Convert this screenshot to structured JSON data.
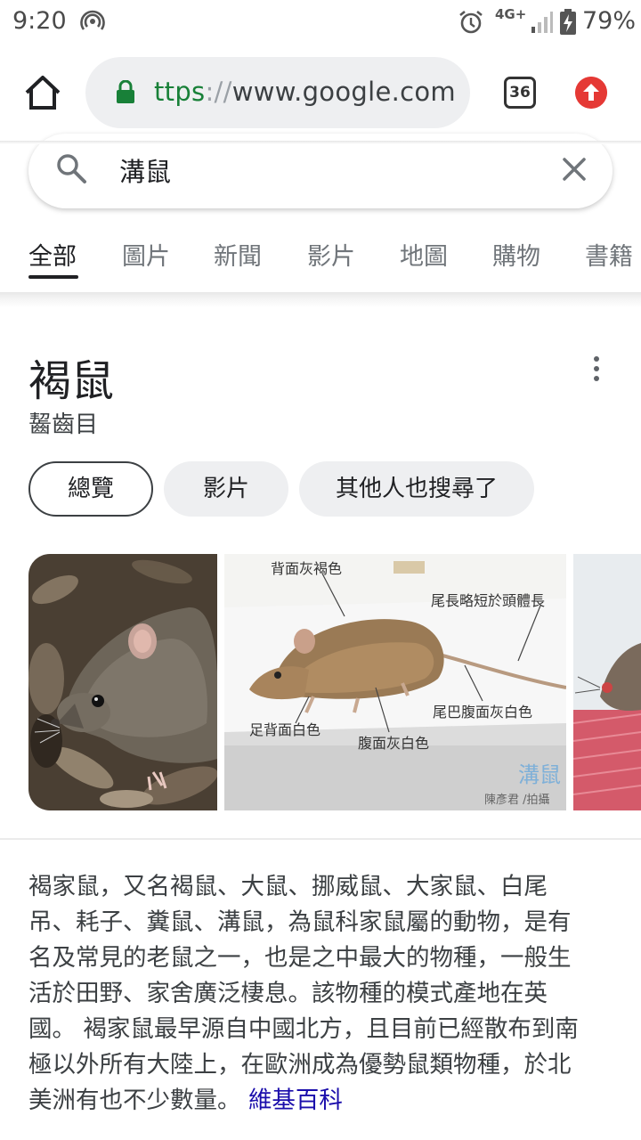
{
  "status_bar": {
    "time": "9:20",
    "network": "4G+",
    "battery": "79%"
  },
  "browser": {
    "url_scheme": "ttps",
    "url_sep": "://",
    "url_host": "www.google.com",
    "tab_count": "36",
    "icons": {
      "home": "home-icon",
      "lock": "lock-icon",
      "update": "update-arrow-icon"
    }
  },
  "search": {
    "query": "溝鼠",
    "icons": {
      "search": "search-icon",
      "clear": "close-icon"
    }
  },
  "tabs": [
    {
      "label": "全部",
      "selected": true
    },
    {
      "label": "圖片",
      "selected": false
    },
    {
      "label": "新聞",
      "selected": false
    },
    {
      "label": "影片",
      "selected": false
    },
    {
      "label": "地圖",
      "selected": false
    },
    {
      "label": "購物",
      "selected": false
    },
    {
      "label": "書籍",
      "selected": false
    }
  ],
  "knowledge_panel": {
    "title": "褐鼠",
    "subtitle": "齧齒目",
    "chips": [
      "總覽",
      "影片",
      "其他人也搜尋了"
    ],
    "image_labels": {
      "back": "背面灰褐色",
      "tail_length": "尾長略短於頭體長",
      "tail_belly": "尾巴腹面灰白色",
      "foot": "足背面白色",
      "belly": "腹面灰白色",
      "watermark": "溝鼠",
      "credit": "陳彥君 /拍攝"
    },
    "description_lines": [
      "褐家鼠，又名褐鼠、大鼠、挪威鼠、大家鼠、白尾",
      "吊、耗子、糞鼠、溝鼠，為鼠科家鼠屬的動物，是有",
      "名及常見的老鼠之一，也是之中最大的物種，一般生",
      "活於田野、家舍廣泛棲息。該物種的模式產地在英",
      "國。 褐家鼠最早源自中國北方，且目前已經散布到南",
      "極以外所有大陸上，在歐洲成為優勢鼠類物種，於北",
      "美洲有也不少數量。 "
    ],
    "wiki_link": "維基百科"
  },
  "colors": {
    "link": "#1a0dab",
    "secure_green": "#188038",
    "update_red": "#e53935"
  }
}
